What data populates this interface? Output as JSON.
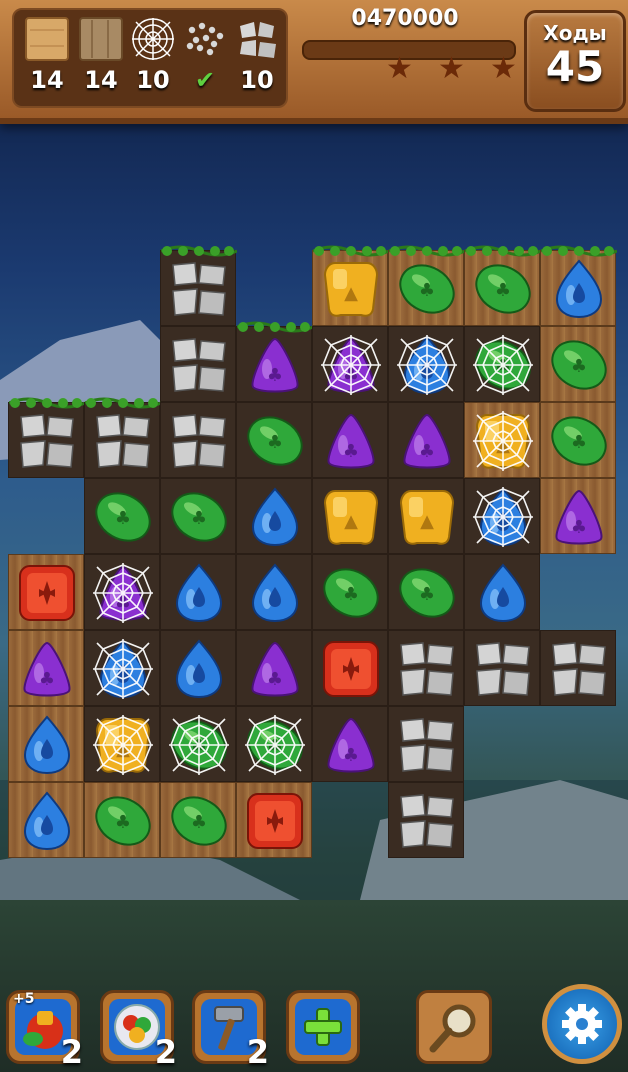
{
  "header": {
    "goals": [
      {
        "icon": "wood-block-icon",
        "count": "14"
      },
      {
        "icon": "wood-plank-icon",
        "count": "14"
      },
      {
        "icon": "spider-web-icon",
        "count": "10"
      },
      {
        "icon": "gravel-icon",
        "count": "",
        "done": true
      },
      {
        "icon": "stone-icon",
        "count": "10"
      }
    ],
    "score": "0470000",
    "score_progress": 0.0,
    "stars_total": 3,
    "moves_label": "Ходы",
    "moves_value": "45"
  },
  "board": {
    "rows": [
      [
        "empty",
        "empty",
        "stone",
        "empty",
        "gem-yellow",
        "gem-green",
        "gem-green",
        "gem-blue"
      ],
      [
        "empty",
        "empty",
        "stone",
        "gem-purple",
        "web-purple",
        "web-blue",
        "web-green",
        "gem-green"
      ],
      [
        "stone",
        "stone",
        "stone",
        "gem-green",
        "gem-purple",
        "gem-purple",
        "web-yellow",
        "gem-green"
      ],
      [
        "empty",
        "gem-green",
        "gem-green",
        "gem-blue",
        "gem-yellow",
        "gem-yellow",
        "web-blue",
        "gem-purple"
      ],
      [
        "gem-red",
        "web-purple",
        "gem-blue",
        "gem-blue",
        "gem-green",
        "gem-green",
        "gem-blue",
        "empty"
      ],
      [
        "gem-purple",
        "web-blue",
        "gem-blue",
        "gem-purple",
        "gem-red",
        "stone",
        "stone",
        "stone"
      ],
      [
        "gem-blue",
        "web-yellow",
        "web-green",
        "web-green",
        "gem-purple",
        "stone",
        "empty",
        "empty"
      ],
      [
        "gem-blue",
        "gem-green",
        "gem-green",
        "gem-red",
        "empty",
        "stone",
        "empty",
        "empty"
      ]
    ],
    "wood_cells": [
      [
        0,
        4
      ],
      [
        0,
        5
      ],
      [
        0,
        6
      ],
      [
        0,
        7
      ],
      [
        1,
        7
      ],
      [
        2,
        6
      ],
      [
        2,
        7
      ],
      [
        3,
        7
      ],
      [
        4,
        0
      ],
      [
        5,
        0
      ],
      [
        6,
        0
      ],
      [
        7,
        0
      ],
      [
        7,
        1
      ],
      [
        7,
        2
      ],
      [
        7,
        3
      ]
    ],
    "vines": [
      [
        0,
        2
      ],
      [
        0,
        4
      ],
      [
        0,
        5
      ],
      [
        0,
        6
      ],
      [
        0,
        7
      ],
      [
        1,
        3
      ],
      [
        2,
        0
      ],
      [
        2,
        1
      ]
    ]
  },
  "boosters": [
    {
      "icon": "bomb-booster-icon",
      "count": "2",
      "bonus": "+5"
    },
    {
      "icon": "color-ball-icon",
      "count": "2"
    },
    {
      "icon": "hammer-icon",
      "count": "2"
    },
    {
      "icon": "plus-icon",
      "count": ""
    }
  ],
  "hint_icon": "magnifier-icon",
  "settings_icon": "gear-icon",
  "colors": {
    "gem-green": "#2fa83a",
    "gem-blue": "#2c7fe0",
    "gem-purple": "#8a2fd0",
    "gem-yellow": "#f0b020",
    "gem-red": "#d8301c",
    "web-purple": "#8a2fd0",
    "web-blue": "#2c7fe0",
    "web-green": "#2fa83a",
    "web-yellow": "#f0b020"
  }
}
